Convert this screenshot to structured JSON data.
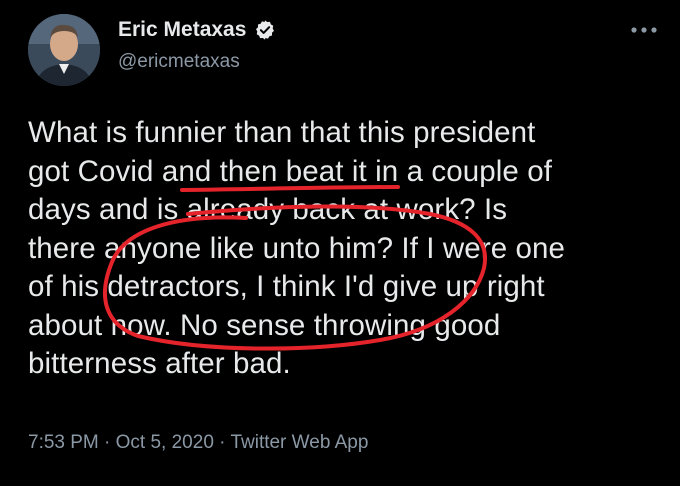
{
  "author": {
    "display_name": "Eric Metaxas",
    "handle": "@ericmetaxas",
    "verified": true,
    "avatar_icon": "profile-photo"
  },
  "tweet": {
    "text_lines": [
      "What is funnier than that this president",
      "got Covid and then beat it in a couple of",
      "days and is already back at work? Is",
      "there anyone like unto him? If I were one",
      "of his detractors, I think I'd give up right",
      "about now. No sense throwing good",
      "bitterness after bad."
    ]
  },
  "meta": {
    "time": "7:53 PM",
    "separator": " · ",
    "date": "Oct 5, 2020",
    "source": "Twitter Web App"
  },
  "colors": {
    "background": "#000000",
    "text": "#e7e9ea",
    "secondary": "#8b98a5",
    "annotation": "#e5232a"
  },
  "icons": {
    "verified": "verified-badge-icon",
    "more": "more-options-icon"
  }
}
